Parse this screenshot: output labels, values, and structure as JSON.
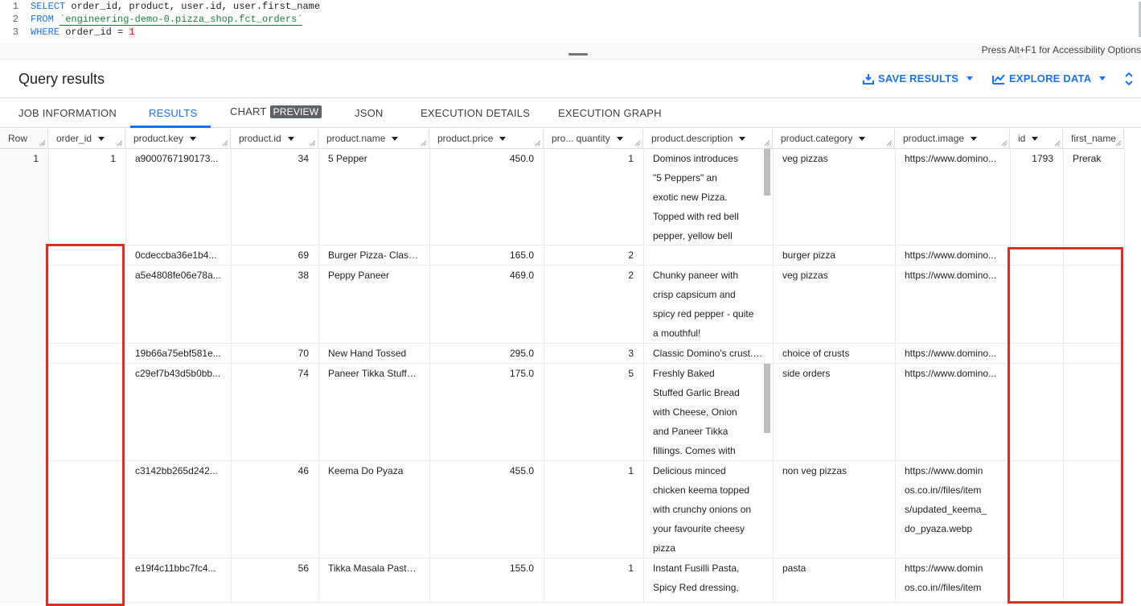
{
  "editor": {
    "lines": [
      {
        "num": "1",
        "parts": [
          {
            "t": "kw",
            "v": "SELECT"
          },
          {
            "t": "txt",
            "v": " order_id, product, user.id, user.first_name"
          }
        ]
      },
      {
        "num": "2",
        "parts": [
          {
            "t": "kw",
            "v": "FROM"
          },
          {
            "t": "txt",
            "v": " "
          },
          {
            "t": "str",
            "v": "`engineering-demo-0.pizza_shop.fct_orders`"
          }
        ]
      },
      {
        "num": "3",
        "parts": [
          {
            "t": "kw",
            "v": "WHERE"
          },
          {
            "t": "txt",
            "v": " order_id = "
          },
          {
            "t": "num",
            "v": "1"
          }
        ]
      }
    ],
    "accessibility_hint": "Press Alt+F1 for Accessibility Options"
  },
  "header": {
    "title": "Query results",
    "save_label": "SAVE RESULTS",
    "explore_label": "EXPLORE DATA",
    "accent": "#1a73e8"
  },
  "tabs": [
    {
      "label": "JOB INFORMATION"
    },
    {
      "label": "RESULTS",
      "active": true
    },
    {
      "label": "CHART",
      "badge": "PREVIEW"
    },
    {
      "label": "JSON"
    },
    {
      "label": "EXECUTION DETAILS"
    },
    {
      "label": "EXECUTION GRAPH"
    }
  ],
  "columns": [
    "Row",
    "order_id",
    "product.key",
    "product.id",
    "product.name",
    "product.price",
    "pro... quantity",
    "product.description",
    "product.category",
    "product.image",
    "id",
    "first_name"
  ],
  "rows": [
    {
      "row": "1",
      "order_id": "1",
      "key": "a9000767190173...",
      "pid": "34",
      "name": "5 Pepper",
      "price": "450.0",
      "qty": "1",
      "desc": [
        "Dominos introduces",
        "\"5 Peppers\" an",
        "exotic new Pizza.",
        "Topped with red bell",
        "pepper, yellow bell"
      ],
      "cat": "veg pizzas",
      "img": [
        "https://www.domino..."
      ],
      "id": "1793",
      "first_name": "Prerak"
    },
    {
      "key": "0cdeccba36e1b4...",
      "pid": "69",
      "name": "Burger Pizza- Class...",
      "price": "165.0",
      "qty": "2",
      "desc": [],
      "cat": "burger pizza",
      "img": [
        "https://www.domino..."
      ]
    },
    {
      "key": "a5e4808fe06e78a...",
      "pid": "38",
      "name": "Peppy Paneer",
      "price": "469.0",
      "qty": "2",
      "desc": [
        "Chunky paneer with",
        "crisp capsicum and",
        "spicy red pepper - quite",
        "a mouthful!"
      ],
      "cat": "veg pizzas",
      "img": [
        "https://www.domino..."
      ]
    },
    {
      "key": "19b66a75ebf581e...",
      "pid": "70",
      "name": "New Hand Tossed",
      "price": "295.0",
      "qty": "3",
      "desc": [
        "Classic Domino's crust. ..."
      ],
      "cat": "choice of crusts",
      "img": [
        "https://www.domino..."
      ]
    },
    {
      "key": "c29ef7b43d5b0bb...",
      "pid": "74",
      "name": "Paneer Tikka Stuffe...",
      "price": "175.0",
      "qty": "5",
      "desc": [
        "Freshly Baked",
        "Stuffed Garlic Bread",
        "with Cheese, Onion",
        "and Paneer Tikka",
        "fillings. Comes with"
      ],
      "cat": "side orders",
      "img": [
        "https://www.domino..."
      ]
    },
    {
      "key": "c3142bb265d242...",
      "pid": "46",
      "name": "Keema Do Pyaza",
      "price": "455.0",
      "qty": "1",
      "desc": [
        "Delicious minced",
        "chicken keema topped",
        "with crunchy onions on",
        "your favourite cheesy",
        "pizza"
      ],
      "cat": "non veg pizzas",
      "img": [
        "https://www.domin",
        "os.co.in//files/item",
        "s/updated_keema_",
        "do_pyaza.webp"
      ]
    },
    {
      "key": "e19f4c11bbc7fc4...",
      "pid": "56",
      "name": "Tikka Masala Pasta...",
      "price": "155.0",
      "qty": "1",
      "desc": [
        "Instant Fusilli Pasta,",
        "Spicy Red dressing,"
      ],
      "cat": "pasta",
      "img": [
        "https://www.domin",
        "os.co.in//files/item"
      ]
    }
  ],
  "highlight_color": "#d93025"
}
